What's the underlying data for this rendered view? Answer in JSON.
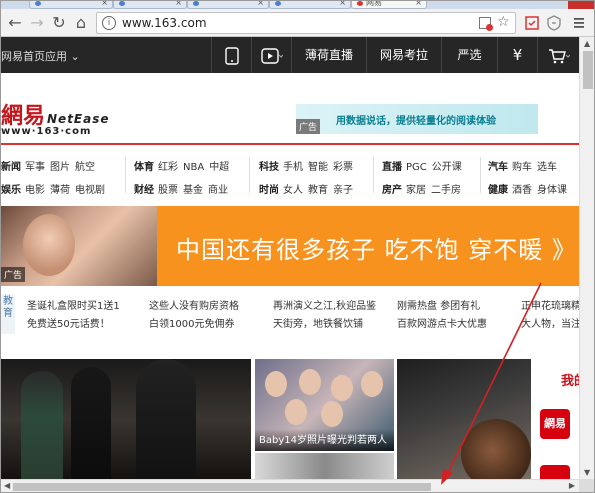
{
  "browser": {
    "address_url": "www.163.com",
    "tab_titles": [
      "",
      "",
      "",
      "",
      "网易"
    ],
    "nav_icons": [
      "back-arrow",
      "forward-arrow",
      "reload",
      "home",
      "info",
      "popup-blocked",
      "bookmark-star",
      "extension-1",
      "extension-2",
      "menu"
    ]
  },
  "topbar": {
    "home": "网易首页",
    "apps": "应用",
    "items": [
      "",
      "",
      "薄荷直播",
      "网易考拉",
      "严选",
      "¥",
      ""
    ]
  },
  "header": {
    "logo_cn": "網易",
    "logo_en": "NetEase",
    "logo_sub": "www·163·com",
    "ad_text": "用数据说话，提供轻量化的阅读体验",
    "ad_tag": "广告"
  },
  "channels": [
    {
      "head": "新闻",
      "items": [
        "军事",
        "图片",
        "航空"
      ]
    },
    {
      "head": "娱乐",
      "items": [
        "电影",
        "薄荷",
        "电视剧"
      ]
    },
    {
      "head": "体育",
      "items": [
        "红彩",
        "NBA",
        "中超"
      ]
    },
    {
      "head": "财经",
      "items": [
        "股票",
        "基金",
        "商业"
      ]
    },
    {
      "head": "科技",
      "items": [
        "手机",
        "智能",
        "彩票"
      ]
    },
    {
      "head": "时尚",
      "items": [
        "女人",
        "教育",
        "亲子"
      ]
    },
    {
      "head": "直播",
      "items": [
        "PGC",
        "公开课"
      ]
    },
    {
      "head": "房产",
      "items": [
        "家居",
        "二手房"
      ]
    },
    {
      "head": "汽车",
      "items": [
        "购车",
        "选车"
      ]
    },
    {
      "head": "健康",
      "items": [
        "酒香",
        "身体课"
      ]
    }
  ],
  "hero": {
    "text": "中国还有很多孩子 吃不饱 穿不暖 》",
    "tag": "广告"
  },
  "news": {
    "edu_label": "教育",
    "links": [
      [
        "圣诞礼盒限时买1送1",
        "免费送50元话费！"
      ],
      [
        "这些人没有购房资格",
        "白领1000元免佣券"
      ],
      [
        "再洲演义之江,秋迎品鉴",
        "天街旁，地铁餐饮铺"
      ],
      [
        "刚需热盘 参团有礼",
        "百款网游点卡大优惠"
      ],
      [
        "正申花琉璃精",
        "大人物，当注"
      ]
    ]
  },
  "photos": {
    "caption_2": "Baby14岁照片曝光判若两人"
  },
  "side": {
    "title": "我的",
    "app_logo": "網易"
  }
}
